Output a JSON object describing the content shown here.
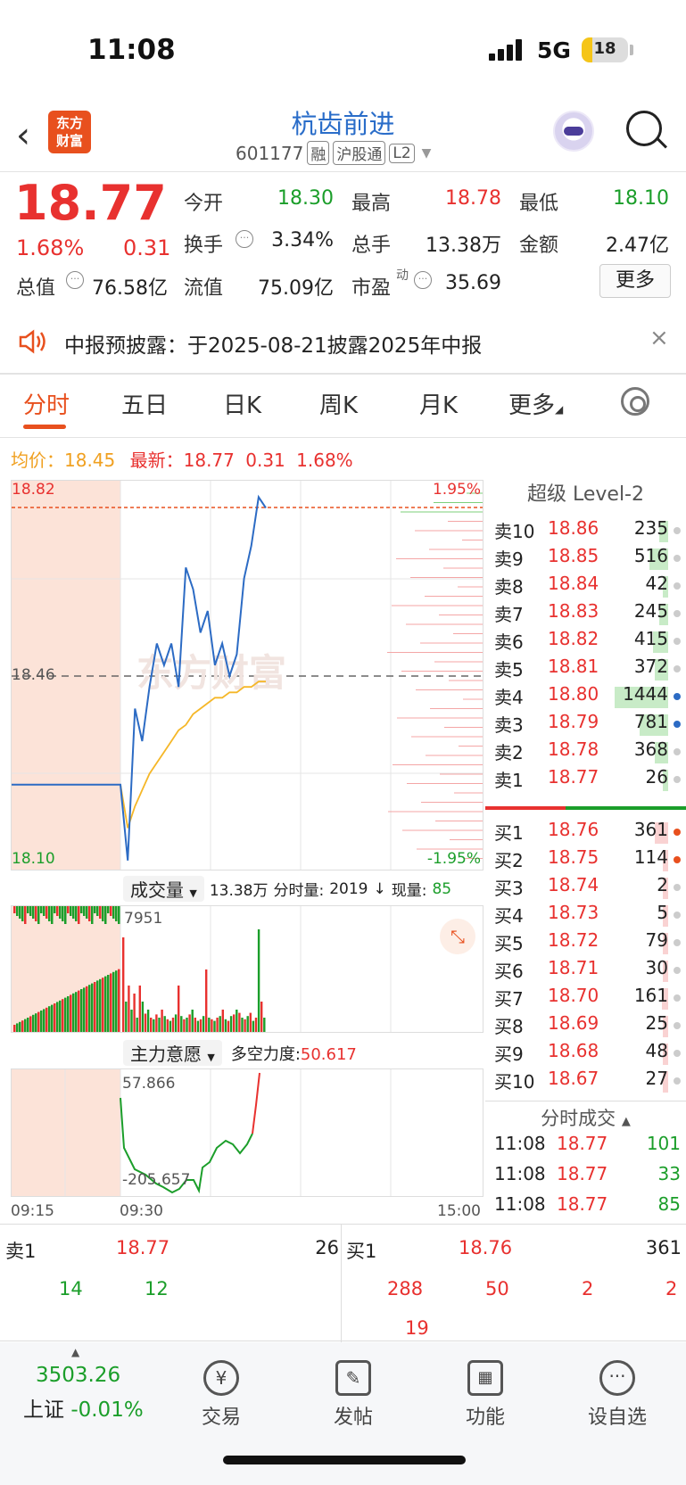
{
  "status": {
    "time": "11:08",
    "network": "5G",
    "battery": "18",
    "battery_level_pct": 18
  },
  "header": {
    "stock_name": "杭齿前进",
    "code": "601177",
    "tags": [
      "融",
      "沪股通",
      "L2"
    ]
  },
  "quote": {
    "price": "18.77",
    "change_pct": "1.68%",
    "change": "0.31",
    "open_label": "今开",
    "open": "18.30",
    "high_label": "最高",
    "high": "18.78",
    "low_label": "最低",
    "low": "18.10",
    "turnover_label": "换手",
    "turnover": "3.34%",
    "volume_label": "总手",
    "volume": "13.38万",
    "amount_label": "金额",
    "amount": "2.47亿",
    "mcap_label": "总值",
    "mcap": "76.58亿",
    "float_label": "流值",
    "float": "75.09亿",
    "pe_label": "市盈",
    "pe_sup": "动",
    "pe": "35.69",
    "more": "更多"
  },
  "notice": {
    "text": "中报预披露：于2025-08-21披露2025年中报",
    "close": "×"
  },
  "tabs": [
    "分时",
    "五日",
    "日K",
    "周K",
    "月K",
    "更多"
  ],
  "summary": {
    "avg_label": "均价：",
    "avg": "18.45",
    "last_label": "最新：",
    "last": "18.77",
    "chg": "0.31",
    "pct": "1.68%"
  },
  "chart": {
    "top_price": "18.82",
    "mid_price": "18.46",
    "bottom_price": "18.10",
    "top_pct": "1.95%",
    "bottom_pct": "-1.95%",
    "watermark": "东方财富",
    "times": [
      "09:15",
      "09:30",
      "15:00"
    ]
  },
  "chart_data": {
    "type": "line",
    "x": [
      "09:15",
      "09:25",
      "09:30",
      "09:35",
      "09:40",
      "09:45",
      "09:50",
      "09:55",
      "10:00",
      "10:05",
      "10:10",
      "10:15",
      "10:20",
      "10:25",
      "10:30",
      "10:35",
      "10:40",
      "10:45",
      "10:50",
      "10:55",
      "11:00",
      "11:05",
      "11:08"
    ],
    "series": [
      {
        "values": [
          18.26,
          18.26,
          18.26,
          18.12,
          18.4,
          18.34,
          18.44,
          18.52,
          18.48,
          18.52,
          18.44,
          18.66,
          18.62,
          18.54,
          18.58,
          18.48,
          18.52,
          18.46,
          18.5,
          18.64,
          18.7,
          18.79,
          18.77
        ]
      },
      {
        "values": [
          18.26,
          18.26,
          18.26,
          18.18,
          18.22,
          18.25,
          18.28,
          18.3,
          18.32,
          18.34,
          18.36,
          18.37,
          18.39,
          18.4,
          18.41,
          18.42,
          18.42,
          18.43,
          18.43,
          18.44,
          18.44,
          18.45,
          18.45
        ]
      }
    ],
    "ylim": [
      18.1,
      18.82
    ]
  },
  "volume": {
    "label": "成交量",
    "total": "13.38万",
    "minute_label": "分时量:",
    "minute": "2019",
    "now_label": "现量:",
    "now": "85",
    "max": "7951"
  },
  "force": {
    "label": "主力意愿",
    "power_label": "多空力度:",
    "power": "50.617",
    "max": "57.866",
    "min": "-205.657"
  },
  "book": {
    "title": "超级 Level-2",
    "asks": [
      {
        "n": "卖10",
        "p": "18.86",
        "q": "235"
      },
      {
        "n": "卖9",
        "p": "18.85",
        "q": "516"
      },
      {
        "n": "卖8",
        "p": "18.84",
        "q": "42"
      },
      {
        "n": "卖7",
        "p": "18.83",
        "q": "245"
      },
      {
        "n": "卖6",
        "p": "18.82",
        "q": "415"
      },
      {
        "n": "卖5",
        "p": "18.81",
        "q": "372"
      },
      {
        "n": "卖4",
        "p": "18.80",
        "q": "1444"
      },
      {
        "n": "卖3",
        "p": "18.79",
        "q": "781"
      },
      {
        "n": "卖2",
        "p": "18.78",
        "q": "368"
      },
      {
        "n": "卖1",
        "p": "18.77",
        "q": "26"
      }
    ],
    "bids": [
      {
        "n": "买1",
        "p": "18.76",
        "q": "361"
      },
      {
        "n": "买2",
        "p": "18.75",
        "q": "114"
      },
      {
        "n": "买3",
        "p": "18.74",
        "q": "2"
      },
      {
        "n": "买4",
        "p": "18.73",
        "q": "5"
      },
      {
        "n": "买5",
        "p": "18.72",
        "q": "79"
      },
      {
        "n": "买6",
        "p": "18.71",
        "q": "30"
      },
      {
        "n": "买7",
        "p": "18.70",
        "q": "161"
      },
      {
        "n": "买8",
        "p": "18.69",
        "q": "25"
      },
      {
        "n": "买9",
        "p": "18.68",
        "q": "48"
      },
      {
        "n": "买10",
        "p": "18.67",
        "q": "27"
      }
    ],
    "trades_title": "分时成交",
    "trades": [
      {
        "t": "11:08",
        "p": "18.77",
        "q": "101"
      },
      {
        "t": "11:08",
        "p": "18.77",
        "q": "33"
      },
      {
        "t": "11:08",
        "p": "18.77",
        "q": "85"
      }
    ]
  },
  "queue": {
    "ask_label": "卖1",
    "ask_price": "18.77",
    "ask_qty": "26",
    "ask_orders": [
      "14",
      "12"
    ],
    "bid_label": "买1",
    "bid_price": "18.76",
    "bid_qty": "361",
    "bid_orders": [
      "288",
      "50",
      "2",
      "2",
      "19"
    ]
  },
  "tabbar": {
    "index_value": "3503.26",
    "index_name": "上证",
    "index_chg": "-0.01%",
    "items": [
      "交易",
      "发帖",
      "功能",
      "设自选"
    ]
  }
}
